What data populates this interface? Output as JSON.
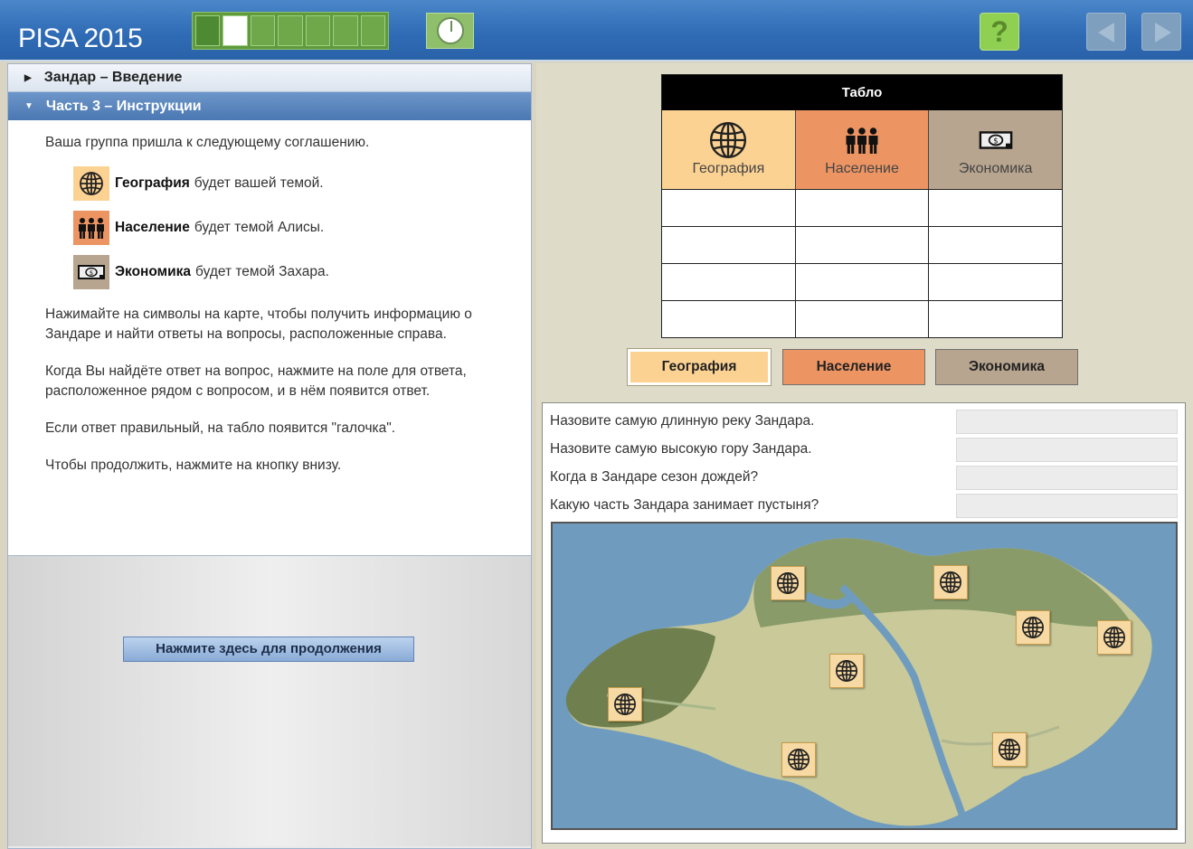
{
  "header": {
    "app_title": "PISA 2015",
    "progress": {
      "total_steps": 7,
      "completed": 1,
      "current_step": 2
    },
    "help_label": "?"
  },
  "sidebar": {
    "sections": [
      {
        "label": "Зандар – Введение",
        "expanded": false
      },
      {
        "label": "Часть 3 – Инструкции",
        "expanded": true
      }
    ],
    "intro_text": "Ваша группа пришла к следующему соглашению.",
    "assignments": [
      {
        "icon": "globe-icon",
        "topic": "География",
        "text": "будет вашей темой."
      },
      {
        "icon": "people-icon",
        "topic": "Население",
        "text": "будет темой Алисы."
      },
      {
        "icon": "money-icon",
        "topic": "Экономика",
        "text": "будет темой Захара."
      }
    ],
    "paragraphs": [
      "Нажимайте на символы на карте, чтобы получить информацию о Зандаре и найти ответы на вопросы, расположенные справа.",
      "Когда Вы найдёте ответ на вопрос, нажмите на поле для ответа, расположенное рядом с вопросом, и в нём появится ответ.",
      "Если ответ правильный, на табло появится \"галочка\".",
      "Чтобы продолжить, нажмите на кнопку внизу."
    ],
    "continue_label": "Нажмите здесь для продолжения"
  },
  "scoreboard": {
    "title": "Табло",
    "columns": [
      "География",
      "Население",
      "Экономика"
    ],
    "rows": [
      [
        "",
        "",
        ""
      ],
      [
        "",
        "",
        ""
      ],
      [
        "",
        "",
        ""
      ],
      [
        "",
        "",
        ""
      ]
    ]
  },
  "topic_tabs": [
    "География",
    "Население",
    "Экономика"
  ],
  "questions": [
    {
      "text": "Назовите самую длинную реку Зандара.",
      "answer": ""
    },
    {
      "text": "Назовите самую высокую гору Зандара.",
      "answer": ""
    },
    {
      "text": "Когда в Зандаре сезон дождей?",
      "answer": ""
    },
    {
      "text": "Какую часть Зандара занимает пустыня?",
      "answer": ""
    }
  ],
  "map": {
    "marker_count": 8,
    "marker_icon": "globe-icon"
  },
  "colors": {
    "header_blue": "#2f6bb5",
    "geography": "#fcd293",
    "population": "#ec9563",
    "economy": "#b8a58f",
    "accordion_active": "#4b78b3"
  }
}
